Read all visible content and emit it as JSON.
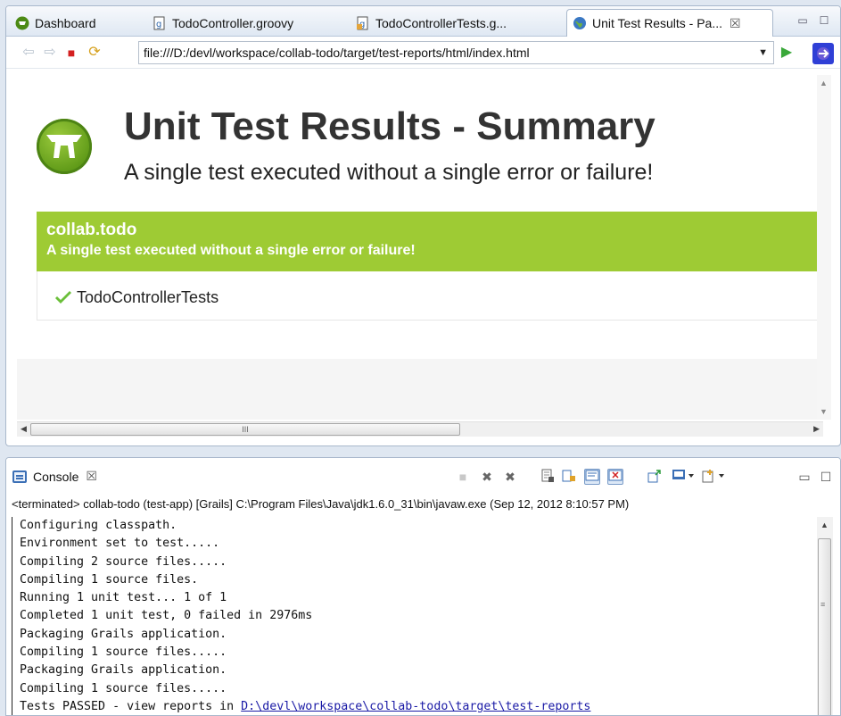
{
  "editor": {
    "tabs": [
      {
        "label": "Dashboard",
        "icon": "grails-icon",
        "active": false
      },
      {
        "label": "TodoController.groovy",
        "icon": "groovy-file-icon",
        "active": false
      },
      {
        "label": "TodoControllerTests.g...",
        "icon": "groovy-file-icon",
        "active": false
      },
      {
        "label": "Unit Test Results - Pa...",
        "icon": "globe-icon",
        "active": true
      }
    ],
    "tab_close": "☒",
    "minimize": "▭",
    "maximize": "☐"
  },
  "navigation": {
    "back_icon": "⇦",
    "forward_icon": "⇨",
    "stop_icon": "■",
    "refresh_icon": "⟳",
    "url": "file:///D:/devl/workspace/collab-todo/target/test-reports/html/index.html",
    "dropdown_icon": "▼",
    "go_icon": "▶"
  },
  "report": {
    "title": "Unit Test Results - Summary",
    "subtitle": "A single test executed without a single error or failure!",
    "package": {
      "name": "collab.todo",
      "description": "A single test executed without a single error or failure!",
      "tests": [
        {
          "name": "TodoControllerTests",
          "status": "passed"
        }
      ]
    }
  },
  "scrollbars": {
    "up": "▲",
    "down": "▼",
    "left": "◀",
    "right": "▶",
    "grip": "III"
  },
  "console": {
    "tab_label": "Console",
    "tab_close": "☒",
    "status": "<terminated> collab-todo (test-app) [Grails] C:\\Program Files\\Java\\jdk1.6.0_31\\bin\\javaw.exe (Sep 12, 2012 8:10:57 PM)",
    "lines": [
      "Configuring classpath.",
      "Environment set to test.....",
      "Compiling 2 source files.....",
      "Compiling 1 source files.",
      "Running 1 unit test... 1 of 1",
      "Completed 1 unit test, 0 failed in 2976ms",
      "Packaging Grails application.",
      "Compiling 1 source files.....",
      "Packaging Grails application.",
      "Compiling 1 source files.....",
      "Tests PASSED - view reports in "
    ],
    "report_link": "D:\\devl\\workspace\\collab-todo\\target\\test-reports",
    "scroll_grip": "≡"
  },
  "colors": {
    "package_bar": "#9ecb34",
    "title": "#333333",
    "link": "#1a1aa6"
  }
}
